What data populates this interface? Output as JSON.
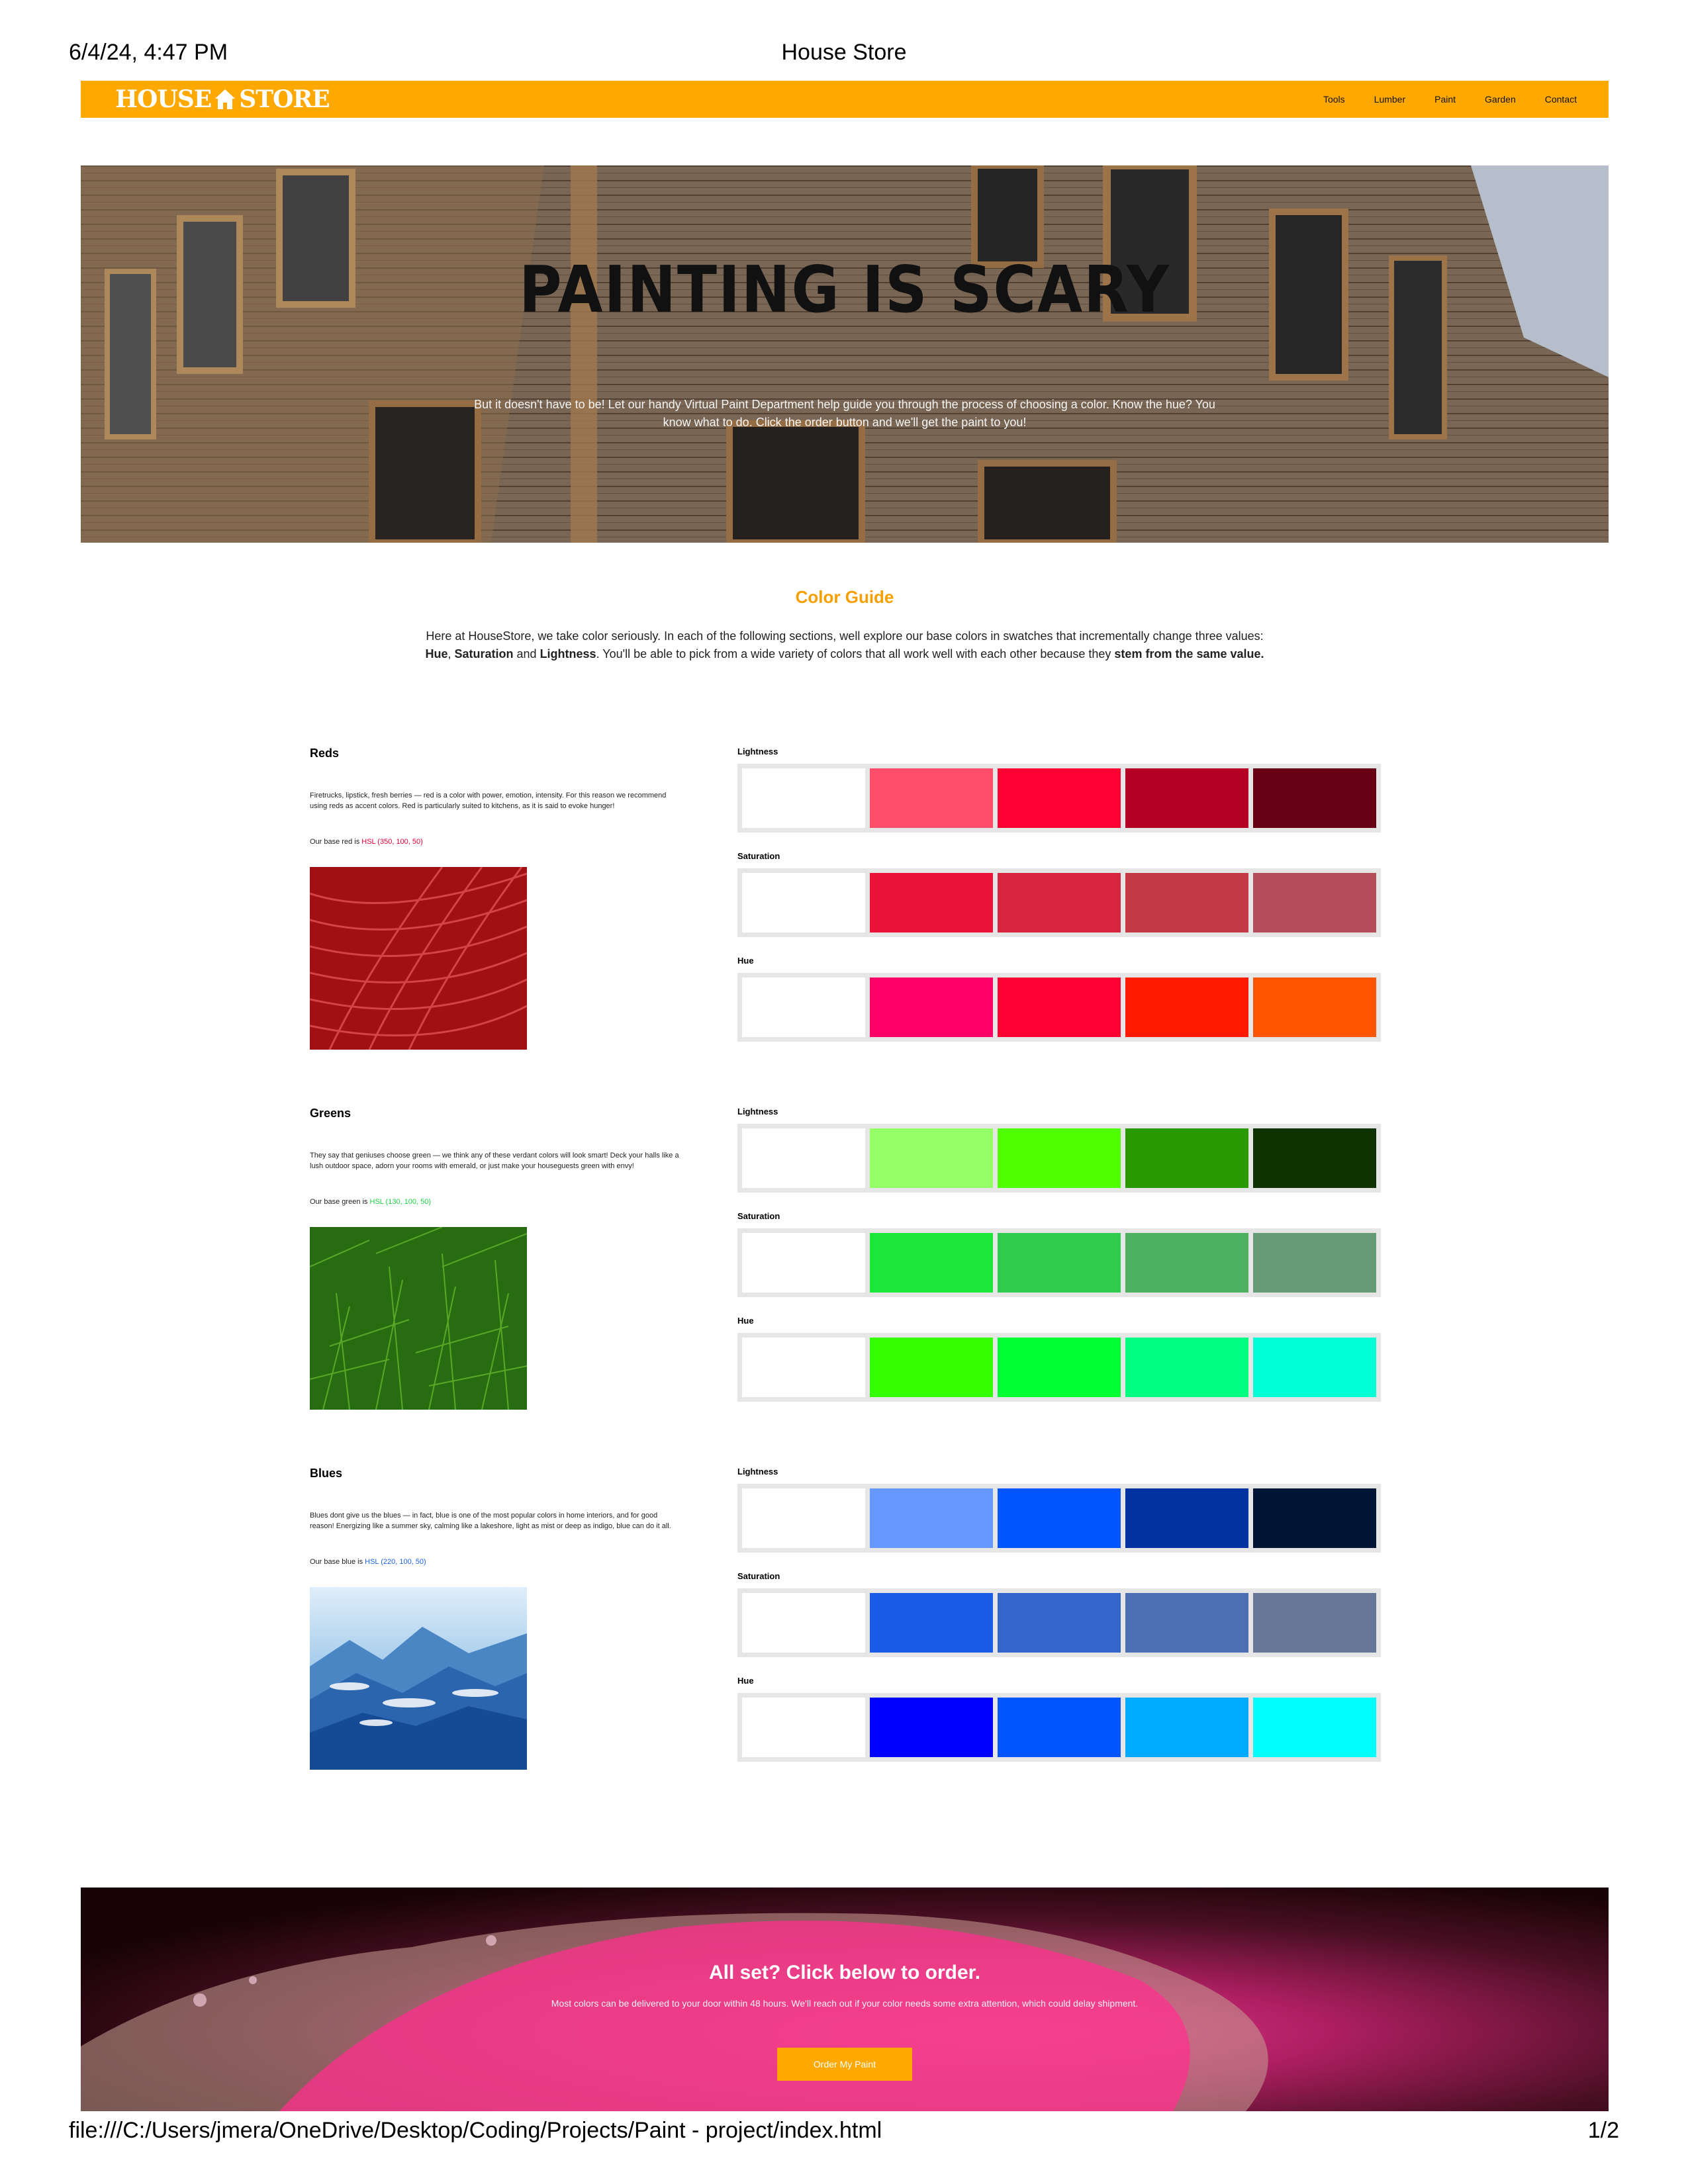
{
  "print": {
    "date": "6/4/24, 4:47 PM",
    "title": "House Store",
    "url": "file:///C:/Users/jmera/OneDrive/Desktop/Coding/Projects/Paint - project/index.html",
    "pages": "1/2"
  },
  "nav": {
    "logo_left": "HOUSE",
    "logo_right": "STORE",
    "logo_icon": "house-icon",
    "links": [
      "Tools",
      "Lumber",
      "Paint",
      "Garden",
      "Contact"
    ]
  },
  "hero": {
    "title": "PAINTING IS SCARY",
    "text": "But it doesn't have to be! Let our handy Virtual Paint Department help guide you through the process of choosing a color. Know the hue? You know what to do. Click the order button and we'll get the paint to you!"
  },
  "guide": {
    "title": "Color Guide",
    "intro_1": "Here at HouseStore, we take color seriously. In each of the following sections, well explore our base colors in swatches that incrementally change three values: ",
    "intro_hue": "Hue",
    "intro_comma": ", ",
    "intro_sat": "Saturation",
    "intro_and": " and ",
    "intro_light": "Lightness",
    "intro_2": ". You'll be able to pick from a wide variety of colors that all work well with each other because they ",
    "intro_bold_end": "stem from the same value."
  },
  "labels": {
    "lightness": "Lightness",
    "saturation": "Saturation",
    "hue": "Hue"
  },
  "sections": [
    {
      "heading": "Reds",
      "desc": "Firetrucks, lipstick, fresh berries — red is a color with power, emotion, intensity. For this reason we recommend using reds as accent colors. Red is particularly suited to kitchens, as it is said to evoke hunger!",
      "base_prefix": "Our base red is ",
      "base_value": "HSL (350, 100, 50)",
      "accent": "#e0003a",
      "lightness": [
        "#ffffff",
        "#ff4d6a",
        "#ff0033",
        "#b30024",
        "#660014"
      ],
      "saturation": [
        "#ffffff",
        "#ec1338",
        "#d9263f",
        "#c63946",
        "#b34d59"
      ],
      "hue": [
        "#ffffff",
        "#ff0066",
        "#ff0033",
        "#ff1a00",
        "#ff5500"
      ]
    },
    {
      "heading": "Greens",
      "desc": "They say that geniuses choose green — we think any of these verdant colors will look smart! Deck your halls like a lush outdoor space, adorn your rooms with emerald, or just make your houseguests green with envy!",
      "base_prefix": "Our base green is ",
      "base_value": "HSL (130, 100, 50)",
      "accent": "#1fd144",
      "lightness": [
        "#ffffff",
        "#94ff66",
        "#4dff00",
        "#2a9900",
        "#0f3300"
      ],
      "saturation": [
        "#ffffff",
        "#1ce83a",
        "#2dcc4f",
        "#4db161",
        "#669975"
      ],
      "hue": [
        "#ffffff",
        "#33ff00",
        "#00ff33",
        "#00ff80",
        "#00ffd5"
      ]
    },
    {
      "heading": "Blues",
      "desc": "Blues dont give us the blues — in fact, blue is one of the most popular colors in home interiors, and for good reason! Energizing like a summer sky, calming like a lakeshore, light as mist or deep as indigo, blue can do it all.",
      "base_prefix": "Our base blue is ",
      "base_value": "HSL (220, 100, 50)",
      "accent": "#1e62e0",
      "lightness": [
        "#ffffff",
        "#6699ff",
        "#0055ff",
        "#0033a0",
        "#001433"
      ],
      "saturation": [
        "#ffffff",
        "#1a5ce6",
        "#3366cc",
        "#4d6eb3",
        "#667799"
      ],
      "hue": [
        "#ffffff",
        "#0000ff",
        "#0055ff",
        "#00aaff",
        "#00ffff"
      ]
    }
  ],
  "cta": {
    "title": "All set? Click below to order.",
    "text": "Most colors can be delivered to your door within 48 hours. We'll reach out if your color needs some extra attention, which could delay shipment.",
    "button": "Order My Paint"
  },
  "colors": {
    "brand": "#ffa800",
    "heading_accent": "#f5a000"
  }
}
